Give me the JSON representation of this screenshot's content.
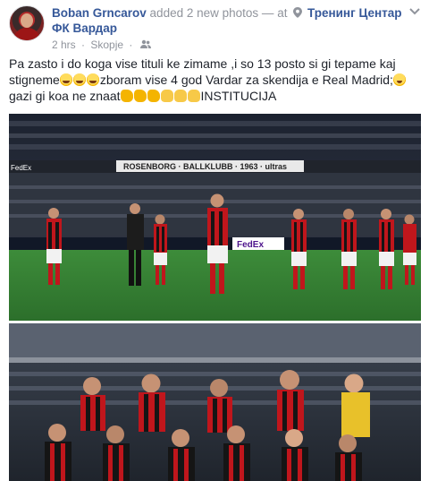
{
  "post": {
    "author_name": "Boban Grncarov",
    "action_text": "added 2 new photos",
    "separator": "—",
    "at_text": "at",
    "place_line1": "Тренинг Центар",
    "place_line2": "ФК Вардар",
    "time": "2 hrs",
    "meta_dot": "·",
    "location": "Skopje",
    "privacy_icon": "friends-icon",
    "text_part1": "Pa zasto i do koga vise tituli ke zimame ,i so 13 posto si gi tepame kaj stigneme",
    "text_part2": "zboram vise 4 god Vardar za skendija e Real Madrid;",
    "text_part3": "gazi gi koa ne znaat",
    "text_part4": "INSTITUCIJA",
    "photo1_banner_text": "ROSENBORG · BALLKLUBB · 1963 · ultras",
    "photo1_ad_text": "FedEx",
    "photo1_board_text": "FedEx"
  },
  "colors": {
    "link": "#365899",
    "muted": "#90949c",
    "text": "#1d2129",
    "kit_red": "#c0161c",
    "kit_black": "#151515",
    "pitch": "#2f7d32"
  }
}
